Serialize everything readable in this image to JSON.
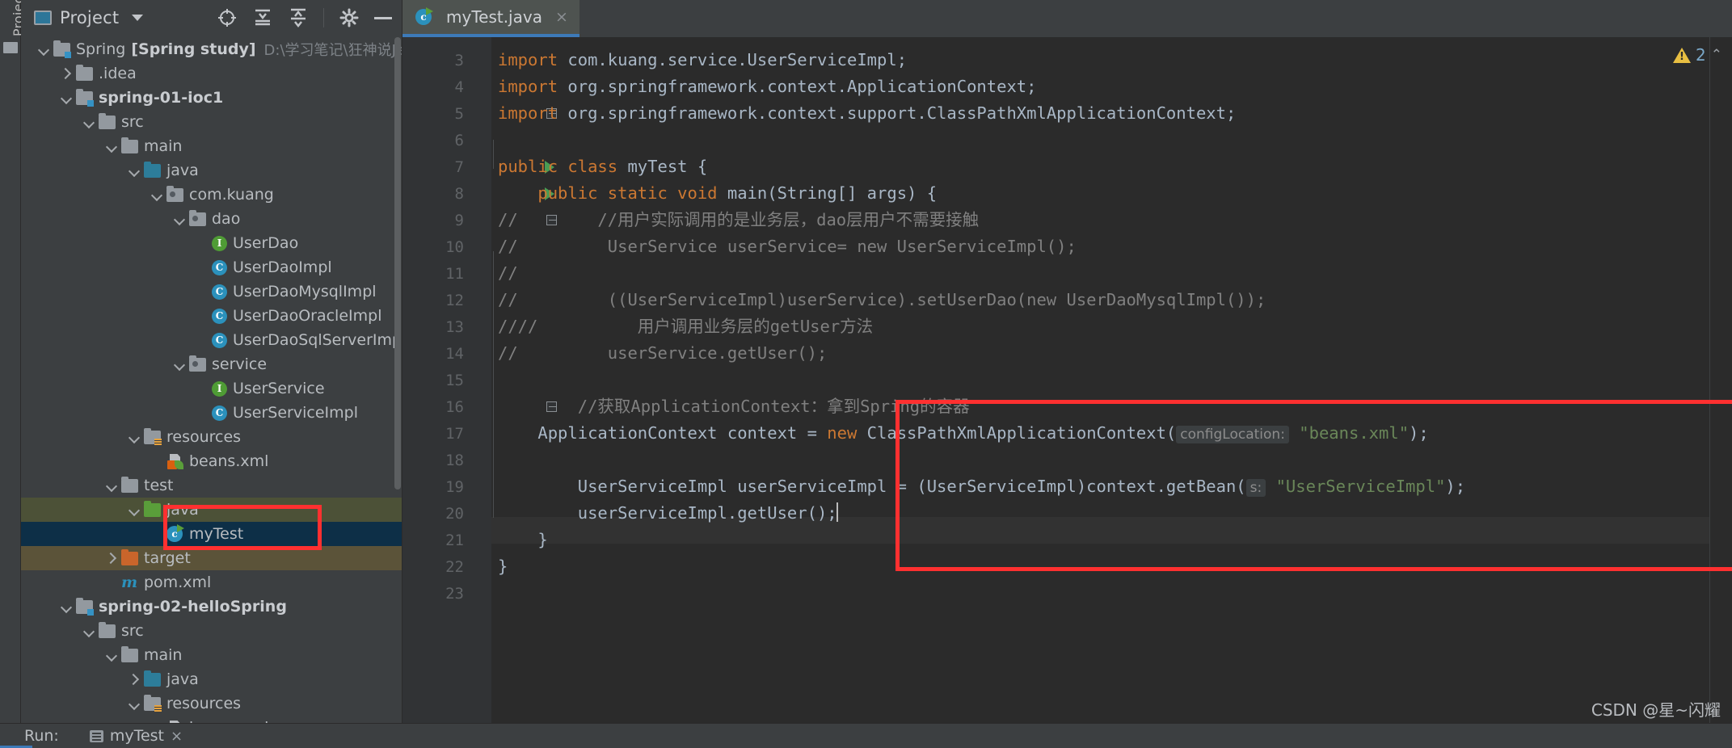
{
  "window": {
    "left_strip_tab": "Project"
  },
  "project_panel": {
    "title": "Project",
    "toolbar_icons": [
      "locate-target-icon",
      "collapse-all-icon",
      "expand-all-icon",
      "gear-icon",
      "hide-icon"
    ],
    "tree": [
      {
        "depth": 0,
        "twisty": "down",
        "icon": "module-folder-icon",
        "label": "Spring",
        "bold_label": "[Spring study]",
        "path": "D:\\学习笔记\\狂神说Java\\S",
        "state": "normal"
      },
      {
        "depth": 1,
        "twisty": "right",
        "icon": "folder-icon",
        "label": ".idea",
        "state": "normal"
      },
      {
        "depth": 1,
        "twisty": "down",
        "icon": "module-folder-icon",
        "label": "spring-01-ioc1",
        "bold": true,
        "state": "normal"
      },
      {
        "depth": 2,
        "twisty": "down",
        "icon": "folder-icon",
        "label": "src",
        "state": "normal"
      },
      {
        "depth": 3,
        "twisty": "down",
        "icon": "folder-icon",
        "label": "main",
        "state": "normal"
      },
      {
        "depth": 4,
        "twisty": "down",
        "icon": "source-folder-icon",
        "label": "java",
        "state": "normal"
      },
      {
        "depth": 5,
        "twisty": "down",
        "icon": "package-icon",
        "label": "com.kuang",
        "state": "normal"
      },
      {
        "depth": 6,
        "twisty": "down",
        "icon": "package-icon",
        "label": "dao",
        "state": "normal"
      },
      {
        "depth": 7,
        "twisty": "none",
        "icon": "interface-icon",
        "label": "UserDao",
        "state": "normal"
      },
      {
        "depth": 7,
        "twisty": "none",
        "icon": "class-icon",
        "label": "UserDaoImpl",
        "state": "normal"
      },
      {
        "depth": 7,
        "twisty": "none",
        "icon": "class-icon",
        "label": "UserDaoMysqlImpl",
        "state": "normal"
      },
      {
        "depth": 7,
        "twisty": "none",
        "icon": "class-icon",
        "label": "UserDaoOracleImpl",
        "state": "normal"
      },
      {
        "depth": 7,
        "twisty": "none",
        "icon": "class-icon",
        "label": "UserDaoSqlServerImpl",
        "state": "normal"
      },
      {
        "depth": 6,
        "twisty": "down",
        "icon": "package-icon",
        "label": "service",
        "state": "normal"
      },
      {
        "depth": 7,
        "twisty": "none",
        "icon": "interface-icon",
        "label": "UserService",
        "state": "normal"
      },
      {
        "depth": 7,
        "twisty": "none",
        "icon": "class-icon",
        "label": "UserServiceImpl",
        "state": "normal"
      },
      {
        "depth": 4,
        "twisty": "down",
        "icon": "resources-folder-icon",
        "label": "resources",
        "state": "normal"
      },
      {
        "depth": 5,
        "twisty": "none",
        "icon": "spring-xml-icon",
        "label": "beans.xml",
        "state": "normal"
      },
      {
        "depth": 3,
        "twisty": "down",
        "icon": "folder-icon",
        "label": "test",
        "state": "normal"
      },
      {
        "depth": 4,
        "twisty": "down",
        "icon": "test-source-folder-icon",
        "label": "java",
        "state": "selected-green"
      },
      {
        "depth": 5,
        "twisty": "none",
        "icon": "runnable-class-icon",
        "label": "myTest",
        "state": "selected-blue"
      },
      {
        "depth": 3,
        "twisty": "right",
        "icon": "target-folder-icon",
        "label": "target",
        "state": "selected-target"
      },
      {
        "depth": 3,
        "twisty": "none",
        "icon": "maven-pom-icon",
        "label": "pom.xml",
        "state": "normal"
      },
      {
        "depth": 1,
        "twisty": "down",
        "icon": "module-folder-icon",
        "label": "spring-02-helloSpring",
        "bold": true,
        "state": "normal"
      },
      {
        "depth": 2,
        "twisty": "down",
        "icon": "folder-icon",
        "label": "src",
        "state": "normal"
      },
      {
        "depth": 3,
        "twisty": "down",
        "icon": "folder-icon",
        "label": "main",
        "state": "normal"
      },
      {
        "depth": 4,
        "twisty": "right",
        "icon": "source-folder-icon",
        "label": "java",
        "state": "normal"
      },
      {
        "depth": 4,
        "twisty": "down",
        "icon": "resources-folder-icon",
        "label": "resources",
        "state": "normal"
      },
      {
        "depth": 5,
        "twisty": "none",
        "icon": "spring-xml-icon",
        "label": "beans.xml",
        "state": "normal"
      }
    ]
  },
  "editor": {
    "tab": {
      "label": "myTest.java",
      "icon": "runnable-class-icon",
      "close": "×"
    },
    "lines": [
      {
        "no": "3",
        "fold": false,
        "run": false
      },
      {
        "no": "4",
        "fold": false,
        "run": false
      },
      {
        "no": "5",
        "fold": true,
        "run": false
      },
      {
        "no": "6",
        "fold": false,
        "run": false
      },
      {
        "no": "7",
        "fold": false,
        "run": true
      },
      {
        "no": "8",
        "fold": false,
        "run": true
      },
      {
        "no": "9",
        "fold": true,
        "run": false
      },
      {
        "no": "10",
        "fold": false,
        "run": false
      },
      {
        "no": "11",
        "fold": false,
        "run": false
      },
      {
        "no": "12",
        "fold": false,
        "run": false
      },
      {
        "no": "13",
        "fold": false,
        "run": false
      },
      {
        "no": "14",
        "fold": false,
        "run": false
      },
      {
        "no": "15",
        "fold": false,
        "run": false
      },
      {
        "no": "16",
        "fold": true,
        "run": false
      },
      {
        "no": "17",
        "fold": false,
        "run": false
      },
      {
        "no": "18",
        "fold": false,
        "run": false
      },
      {
        "no": "19",
        "fold": false,
        "run": false
      },
      {
        "no": "20",
        "fold": false,
        "run": false
      },
      {
        "no": "21",
        "fold": false,
        "run": false
      },
      {
        "no": "22",
        "fold": false,
        "run": false
      },
      {
        "no": "23",
        "fold": false,
        "run": false
      }
    ],
    "code": {
      "l3_kw": "import",
      "l3_rest": " com.kuang.service.UserServiceImpl;",
      "l4_kw": "import",
      "l4_rest": " org.springframework.context.ApplicationContext;",
      "l5_kw": "import",
      "l5_rest": " org.springframework.context.support.ClassPathXmlApplicationContext;",
      "l7_kw1": "public class ",
      "l7_name": "myTest {",
      "l8_kw1": "    public static void ",
      "l8_name": "main",
      "l8_rest": "(String[] args) {",
      "l9": "//        //用户实际调用的是业务层，dao层用户不需要接触",
      "l10": "//         UserService userService= new UserServiceImpl();",
      "l11": "//",
      "l12": "//         ((UserServiceImpl)userService).setUserDao(new UserDaoMysqlImpl());",
      "l13": "////          用户调用业务层的getUser方法",
      "l14": "//         userService.getUser();",
      "l16": "        //获取ApplicationContext：拿到Spring的容器",
      "l17_a": "    ApplicationContext context = ",
      "l17_kw": "new",
      "l17_b": " ClassPathXmlApplicationContext(",
      "l17_hint": "configLocation:",
      "l17_str": "\"beans.xml\"",
      "l17_c": ");",
      "l19_a": "        UserServiceImpl userServiceImpl = (UserServiceImpl)context.getBean(",
      "l19_hint": "s:",
      "l19_str": "\"UserServiceImpl\"",
      "l19_c": ");",
      "l20": "        userServiceImpl.getUser();",
      "l21": "    }",
      "l22": "}"
    },
    "inspection": {
      "warning_count": "2",
      "warning_icon": "warning-triangle-icon",
      "chevron": "⌃"
    }
  },
  "bottom_bar": {
    "run_label": "Run:",
    "run_config_name": "myTest",
    "close": "×"
  },
  "watermark": "CSDN @星~闪耀",
  "colors": {
    "accent_blue": "#3d7ab8",
    "highlight_red": "#ff3030",
    "selection_blue": "#0d2f47",
    "selection_green": "#4c5137",
    "keyword_orange": "#cc7832",
    "string_green": "#6a8759",
    "comment_gray": "#808080",
    "text_gray": "#a9b7c6"
  }
}
